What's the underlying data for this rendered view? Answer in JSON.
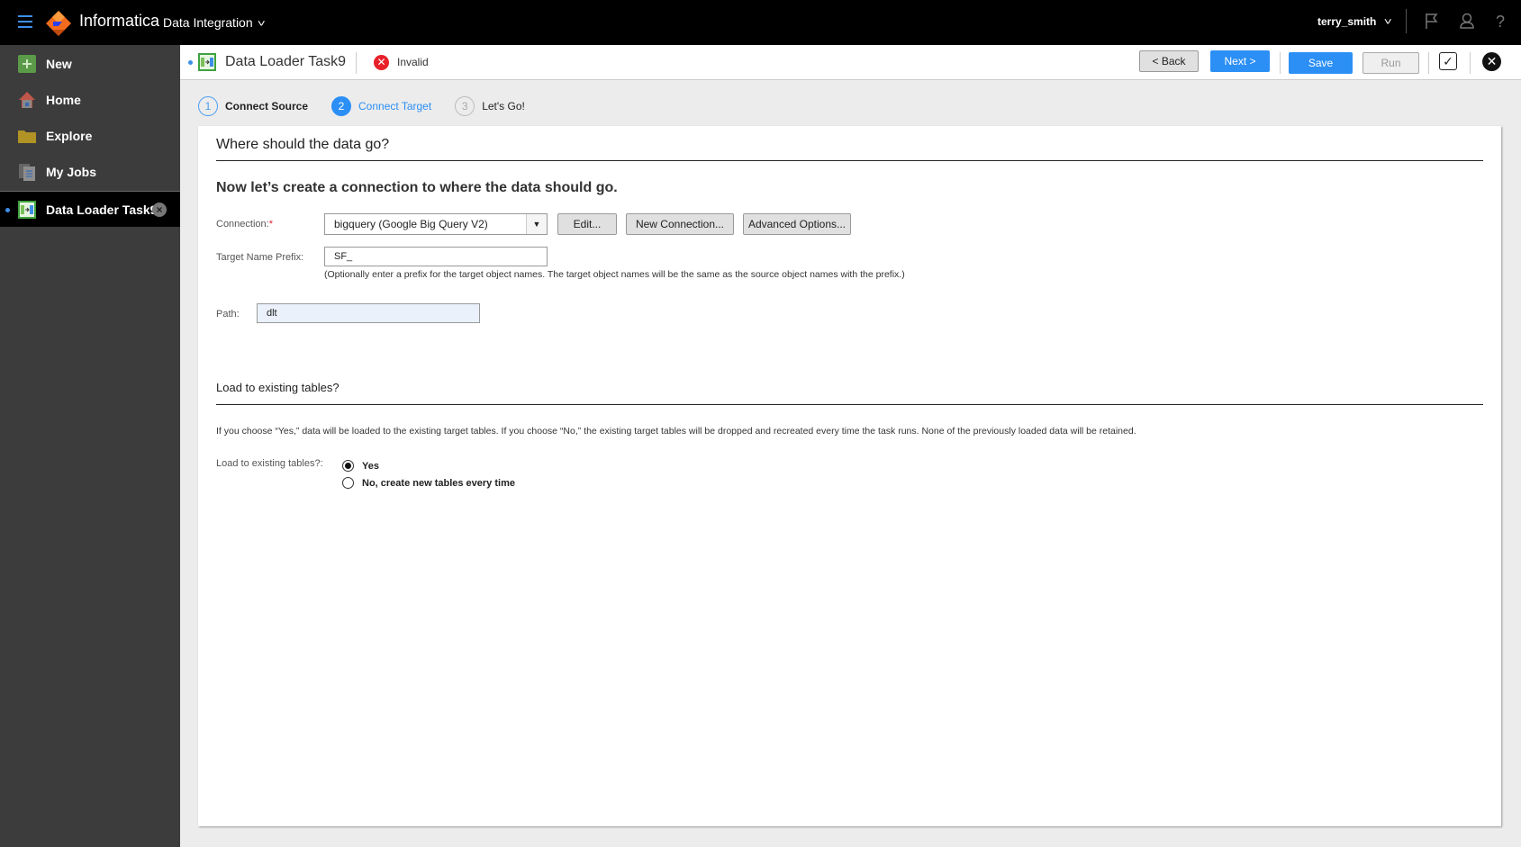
{
  "topbar": {
    "brand": "Informatica",
    "product": "Data Integration",
    "user": "terry_smith",
    "icons": [
      "menu-icon",
      "flag-icon",
      "user-icon",
      "help-icon"
    ],
    "accent": "#3d8ee8"
  },
  "sidebar": {
    "items": [
      {
        "label": "New",
        "icon": "plus-icon"
      },
      {
        "label": "Home",
        "icon": "home-icon"
      },
      {
        "label": "Explore",
        "icon": "folder-icon"
      },
      {
        "label": "My Jobs",
        "icon": "jobs-icon"
      }
    ],
    "open_task": {
      "label": "Data Loader Task9",
      "icon": "data-loader-icon"
    }
  },
  "toolbar": {
    "title": "Data Loader Task9",
    "status": "Invalid",
    "status_color": "#e8202a",
    "back_label": "< Back",
    "next_label": "Next >",
    "save_label": "Save",
    "run_label": "Run",
    "validate_icon": "✓",
    "close_icon": "✕"
  },
  "steps": [
    {
      "num": "1",
      "label": "Connect Source",
      "state": "done"
    },
    {
      "num": "2",
      "label": "Connect Target",
      "state": "current"
    },
    {
      "num": "3",
      "label": "Let's Go!",
      "state": "future"
    }
  ],
  "form": {
    "section_title": "Where should the data go?",
    "subheading": "Now let’s create a connection to where the data should go.",
    "connection_label": "Connection:",
    "required_mark": "*",
    "connection_value": "bigquery (Google Big Query V2)",
    "edit_label": "Edit...",
    "new_connection_label": "New Connection...",
    "advanced_label": "Advanced Options...",
    "prefix_label": "Target Name Prefix:",
    "prefix_value": "SF_",
    "prefix_hint": "(Optionally enter a prefix for the target object names. The target object names will be the same as the source object names with the prefix.)",
    "path_label": "Path:",
    "path_value": "dlt"
  },
  "load_section": {
    "title": "Load to existing tables?",
    "description": "If you choose “Yes,” data will be loaded to the existing target tables. If you choose “No,” the existing target tables will be dropped and recreated every time the task runs. None of the previously loaded data will be retained.",
    "field_label": "Load to existing tables?:",
    "options": [
      {
        "label": "Yes",
        "checked": true
      },
      {
        "label": "No, create new tables every time",
        "checked": false
      }
    ]
  }
}
